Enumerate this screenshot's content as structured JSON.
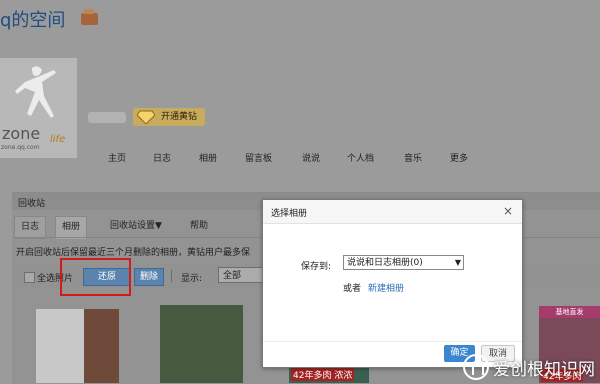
{
  "header": {
    "space_title": "q的空间"
  },
  "profile": {
    "avatar_brand": "zone",
    "avatar_tagline": "life",
    "avatar_url": "zone.qq.com",
    "vip_label": "开通黄钻"
  },
  "nav": {
    "items": [
      "主页",
      "日志",
      "相册",
      "留言板",
      "说说",
      "个人档",
      "音乐",
      "更多"
    ]
  },
  "recycle": {
    "title": "回收站",
    "tabs": [
      "日志",
      "相册",
      "回收站设置▼",
      "帮助"
    ],
    "active_tab": "相册",
    "notice": "开启回收站后保留最近三个月删除的相册，黄钻用户最多保",
    "select_all": "全选照片",
    "restore": "还原",
    "delete": "删除",
    "show": "显示:",
    "filter_value": "全部"
  },
  "thumbnails": {
    "promo_label": "42年多肉  浓浓",
    "store_header": "基地直发",
    "store_label": "42年多肉"
  },
  "dialog": {
    "title": "选择相册",
    "close": "×",
    "save_to_label": "保存到:",
    "album_value": "说说和日志相册(0)",
    "or_label": "或者",
    "new_album": "新建相册",
    "ok": "确定",
    "cancel": "取消"
  },
  "watermark": {
    "text": "爱创根知识网"
  },
  "colors": {
    "link": "#2d6db8",
    "primary_button": "#3b86cf",
    "highlight_frame": "#d31b1b",
    "overlay": "#9b9b9b"
  }
}
